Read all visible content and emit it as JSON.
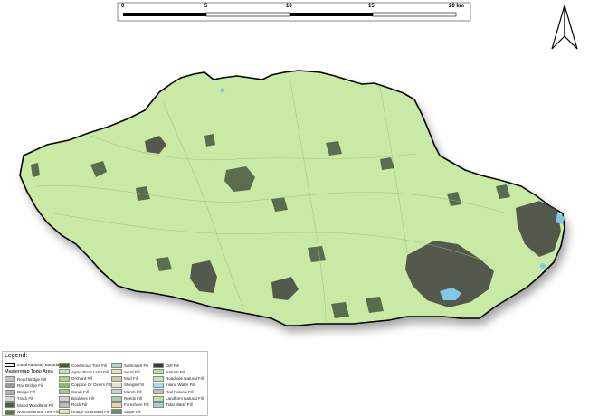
{
  "scale_bar": {
    "ticks": [
      "0",
      "5",
      "10",
      "15",
      "20 km"
    ]
  },
  "north_arrow": {
    "icon": "north-arrow-icon"
  },
  "legend": {
    "title": "Legend:",
    "boundary_label": "Local Authority Boundary",
    "subtitle": "Mastermap Topo Area",
    "columns": [
      [
        {
          "label": "Road Bridge Fill",
          "color": "#c0c0c0"
        },
        {
          "label": "Rail Bridge Fill",
          "color": "#9a9a9a"
        },
        {
          "label": "Bridge Fill",
          "color": "#b0b0b0"
        },
        {
          "label": "Track Fill",
          "color": "#d8d8d8"
        },
        {
          "label": "Mixed Woodland Fill",
          "color": "#4d5f3a"
        },
        {
          "label": "Nonconiferous Tree Fill",
          "color": "#5b7a3f"
        }
      ],
      [
        {
          "label": "Coniferous Tree Fill",
          "color": "#3f5e2f"
        },
        {
          "label": "Agricultural Land Fill",
          "color": "#c9eaa4"
        },
        {
          "label": "Orchard Fill",
          "color": "#a9d884"
        },
        {
          "label": "Coppice Or Osiers Fill",
          "color": "#8fb96b"
        },
        {
          "label": "Scrub Fill",
          "color": "#9ccf7a"
        },
        {
          "label": "Boulders Fill",
          "color": "#cfcfcf"
        },
        {
          "label": "Rock Fill",
          "color": "#bdbdbd"
        },
        {
          "label": "Rough Grassland Fill",
          "color": "#d6efb4"
        }
      ],
      [
        {
          "label": "Saltmarsh Fill",
          "color": "#a8d8c8"
        },
        {
          "label": "Sand Fill",
          "color": "#f2e3a0"
        },
        {
          "label": "Mud Fill",
          "color": "#d9c89a"
        },
        {
          "label": "Shingle Fill",
          "color": "#e3e3d0"
        },
        {
          "label": "Marsh Fill",
          "color": "#b8dcc8"
        },
        {
          "label": "Reeds Fill",
          "color": "#a0d0b0"
        },
        {
          "label": "Foreshore Fill",
          "color": "#ead9a8"
        },
        {
          "label": "Slope Fill",
          "color": "#6a8f5a"
        }
      ],
      [
        {
          "label": "Cliff Fill",
          "color": "#3c3c3c"
        },
        {
          "label": "Natural Fill",
          "color": "#b8e090"
        },
        {
          "label": "Roadside Natural Fill",
          "color": "#c8e8a0"
        },
        {
          "label": "Inland Water Fill",
          "color": "#a6dcef"
        },
        {
          "label": "Rail Natural Fill",
          "color": "#c4c4b0"
        },
        {
          "label": "Landform Natural Fill",
          "color": "#bfe4a0"
        },
        {
          "label": "Tidal Water Fill",
          "color": "#9fd4e6"
        }
      ]
    ]
  },
  "colors": {
    "land": "#c9eaa4",
    "boundary": "#000000",
    "shadow": "#9a9a9a",
    "urban": "#3f3f3f",
    "woodland": "#4f5f45",
    "water": "#7fc8e8"
  }
}
